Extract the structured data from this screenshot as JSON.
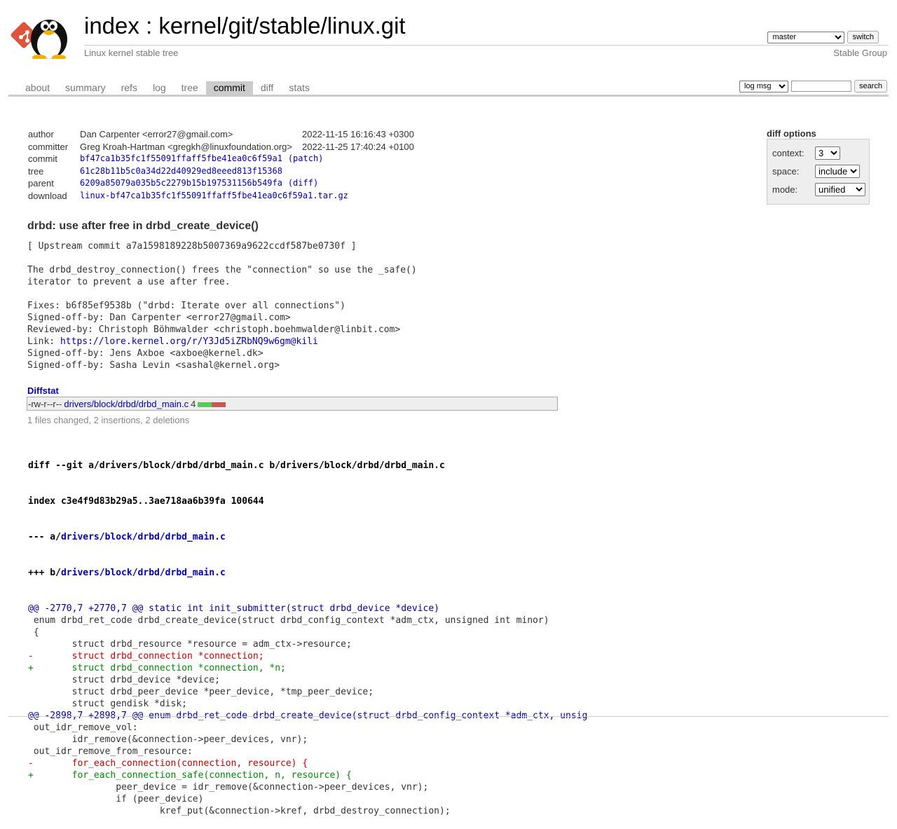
{
  "header": {
    "title_index": "index",
    "title_sep": ":",
    "title_repo": "kernel/git/stable/linux.git",
    "description": "Linux kernel stable tree",
    "owner": "Stable Group",
    "branch": "master",
    "switch_label": "switch"
  },
  "tabs": [
    {
      "label": "about",
      "active": false
    },
    {
      "label": "summary",
      "active": false
    },
    {
      "label": "refs",
      "active": false
    },
    {
      "label": "log",
      "active": false
    },
    {
      "label": "tree",
      "active": false
    },
    {
      "label": "commit",
      "active": true
    },
    {
      "label": "diff",
      "active": false
    },
    {
      "label": "stats",
      "active": false
    }
  ],
  "search": {
    "scope": "log msg",
    "query": "",
    "button": "search"
  },
  "commit_info": {
    "author_label": "author",
    "author": "Dan Carpenter <error27@gmail.com>",
    "author_date": "2022-11-15 16:16:43 +0300",
    "committer_label": "committer",
    "committer": "Greg Kroah-Hartman <gregkh@linuxfoundation.org>",
    "committer_date": "2022-11-25 17:40:24 +0100",
    "commit_label": "commit",
    "commit": "bf47ca1b35fc1f55091ffaff5fbe41ea0c6f59a1",
    "patch_label": "patch",
    "tree_label": "tree",
    "tree": "61c28b11b5c0a34d22d40929ed8eeed813f15368",
    "parent_label": "parent",
    "parent": "6209a85079a035b5c2279b15b197531156b549fa",
    "diff_label": "diff",
    "download_label": "download",
    "download": "linux-bf47ca1b35fc1f55091ffaff5fbe41ea0c6f59a1.tar.gz"
  },
  "diff_options": {
    "title": "diff options",
    "context_label": "context:",
    "context_value": "3",
    "space_label": "space:",
    "space_value": "include",
    "mode_label": "mode:",
    "mode_value": "unified"
  },
  "message": {
    "subject": "drbd: use after free in drbd_create_device()",
    "lines": [
      "[ Upstream commit a7a1598189228b5007369a9622ccdf587be0730f ]",
      "",
      "The drbd_destroy_connection() frees the \"connection\" so use the _safe()",
      "iterator to prevent a use after free.",
      "",
      "Fixes: b6f85ef9538b (\"drbd: Iterate over all connections\")",
      "Signed-off-by: Dan Carpenter <error27@gmail.com>",
      "Reviewed-by: Christoph Böhmwalder <christoph.boehmwalder@linbit.com>",
      "Link: ",
      "Signed-off-by: Jens Axboe <axboe@kernel.dk>",
      "Signed-off-by: Sasha Levin <sashal@kernel.org>"
    ],
    "link_url": "https://lore.kernel.org/r/Y3Jd5iZRbNQ9w6gm@kili"
  },
  "diffstat": {
    "title": "Diffstat",
    "file_mode": "-rw-r--r--",
    "file": "drivers/block/drbd/drbd_main.c",
    "changes": "4",
    "insertions": 2,
    "deletions": 2,
    "summary": "1 files changed, 2 insertions, 2 deletions"
  },
  "diff": {
    "head_line": "diff --git a/drivers/block/drbd/drbd_main.c b/drivers/block/drbd/drbd_main.c",
    "index_line": "index c3e4f9d83b29a5..3ae718aa6b39fa 100644",
    "minus_prefix": "--- a/",
    "plus_prefix": "+++ b/",
    "file_path": "drivers/block/drbd/drbd_main.c",
    "lines": [
      {
        "type": "hunk",
        "text": "@@ -2770,7 +2770,7 @@ static int init_submitter(struct drbd_device *device)"
      },
      {
        "type": "ctx",
        "text": " enum drbd_ret_code drbd_create_device(struct drbd_config_context *adm_ctx, unsigned int minor)"
      },
      {
        "type": "ctx",
        "text": " {"
      },
      {
        "type": "ctx",
        "text": " \tstruct drbd_resource *resource = adm_ctx->resource;"
      },
      {
        "type": "del",
        "text": "-\tstruct drbd_connection *connection;"
      },
      {
        "type": "add",
        "text": "+\tstruct drbd_connection *connection, *n;"
      },
      {
        "type": "ctx",
        "text": " \tstruct drbd_device *device;"
      },
      {
        "type": "ctx",
        "text": " \tstruct drbd_peer_device *peer_device, *tmp_peer_device;"
      },
      {
        "type": "ctx",
        "text": " \tstruct gendisk *disk;"
      },
      {
        "type": "hunk",
        "text": "@@ -2898,7 +2898,7 @@ enum drbd_ret_code drbd_create_device(struct drbd_config_context *adm_ctx, unsig"
      },
      {
        "type": "ctx",
        "text": " out_idr_remove_vol:"
      },
      {
        "type": "ctx",
        "text": " \tidr_remove(&connection->peer_devices, vnr);"
      },
      {
        "type": "ctx",
        "text": " out_idr_remove_from_resource:"
      },
      {
        "type": "del",
        "text": "-\tfor_each_connection(connection, resource) {"
      },
      {
        "type": "add",
        "text": "+\tfor_each_connection_safe(connection, n, resource) {"
      },
      {
        "type": "ctx",
        "text": " \t\tpeer_device = idr_remove(&connection->peer_devices, vnr);"
      },
      {
        "type": "ctx",
        "text": " \t\tif (peer_device)"
      },
      {
        "type": "ctx",
        "text": " \t\t\tkref_put(&connection->kref, drbd_destroy_connection);"
      }
    ]
  },
  "icons": {
    "logo": "git-tux-logo-icon"
  }
}
